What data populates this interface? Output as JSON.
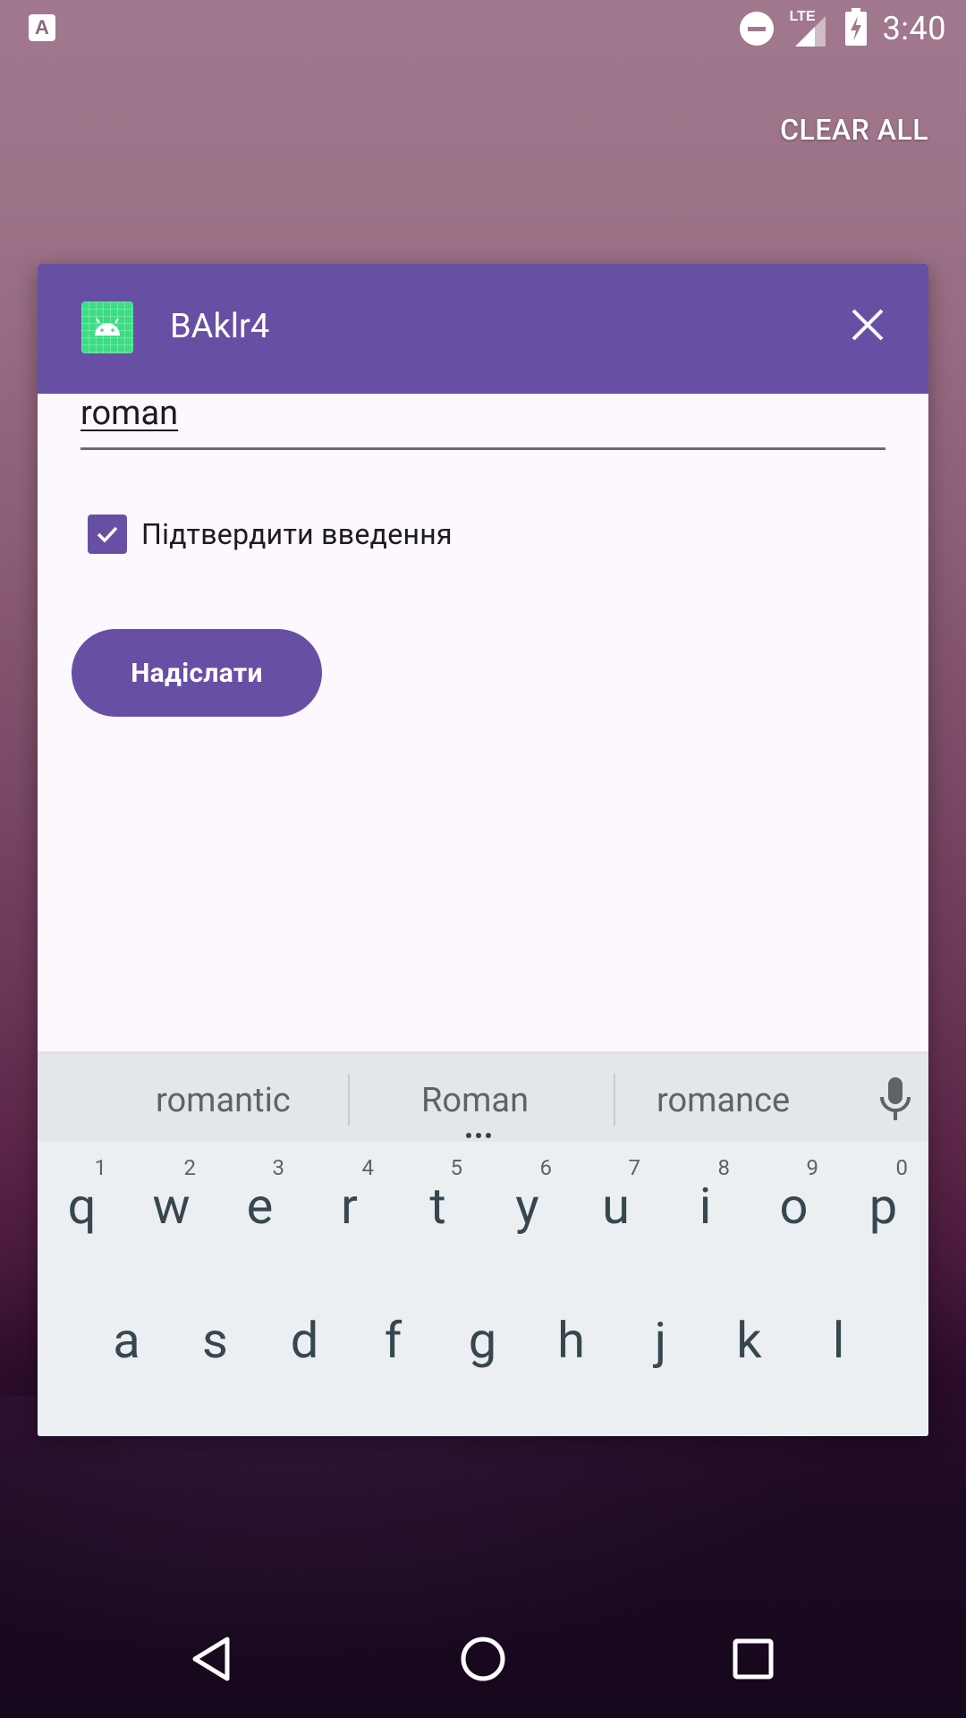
{
  "status_bar": {
    "notification_icon": "A",
    "network_label": "LTE",
    "time": "3:40",
    "icons": [
      "text-notification-icon",
      "do-not-disturb-icon",
      "lte-signal-icon",
      "battery-charging-icon"
    ]
  },
  "recents": {
    "clear_all_label": "CLEAR ALL"
  },
  "app_card": {
    "title": "BAklr4",
    "header_color": "#6750a4",
    "text_field_value": "roman",
    "checkbox_label": "Підтвердити введення",
    "checkbox_checked": true,
    "send_button_label": "Надіслати"
  },
  "keyboard": {
    "suggestions": [
      "romantic",
      "Roman",
      "romance"
    ],
    "row1": [
      {
        "letter": "q",
        "hint": "1"
      },
      {
        "letter": "w",
        "hint": "2"
      },
      {
        "letter": "e",
        "hint": "3"
      },
      {
        "letter": "r",
        "hint": "4"
      },
      {
        "letter": "t",
        "hint": "5"
      },
      {
        "letter": "y",
        "hint": "6"
      },
      {
        "letter": "u",
        "hint": "7"
      },
      {
        "letter": "i",
        "hint": "8"
      },
      {
        "letter": "o",
        "hint": "9"
      },
      {
        "letter": "p",
        "hint": "0"
      }
    ],
    "row2": [
      {
        "letter": "a"
      },
      {
        "letter": "s"
      },
      {
        "letter": "d"
      },
      {
        "letter": "f"
      },
      {
        "letter": "g"
      },
      {
        "letter": "h"
      },
      {
        "letter": "j"
      },
      {
        "letter": "k"
      },
      {
        "letter": "l"
      }
    ]
  },
  "nav_bar": {
    "icons": [
      "back-icon",
      "home-icon",
      "recents-icon"
    ]
  }
}
